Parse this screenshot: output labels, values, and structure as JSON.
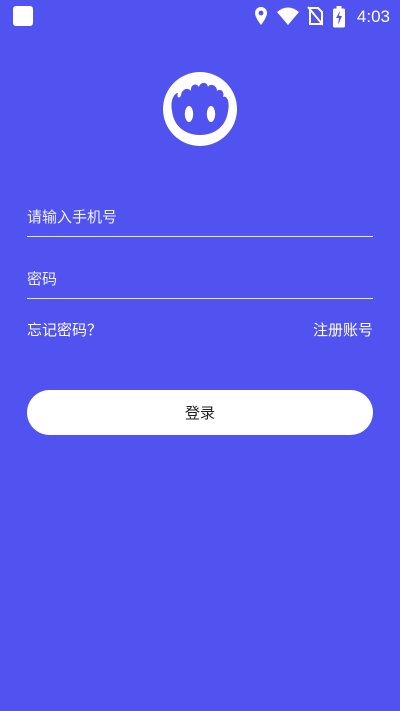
{
  "status_bar": {
    "time": "4:03",
    "icons": [
      "app-square-icon",
      "location-pin-icon",
      "wifi-icon",
      "no-sim-icon",
      "battery-charging-icon"
    ]
  },
  "logo": {
    "icon": "mascot-logo-icon"
  },
  "form": {
    "phone_placeholder": "请输入手机号",
    "phone_value": "",
    "password_placeholder": "密码",
    "password_value": ""
  },
  "links": {
    "forgot_password": "忘记密码？",
    "register": "注册账号"
  },
  "login_button_label": "登录",
  "colors": {
    "background": "#5053ef",
    "button": "#ffffff",
    "button_text": "#222222"
  }
}
